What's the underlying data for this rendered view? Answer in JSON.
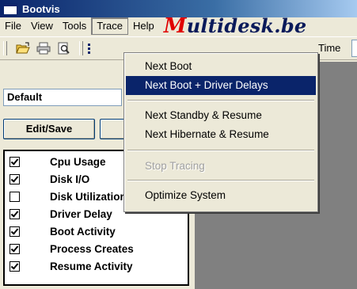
{
  "window": {
    "title": "Bootvis"
  },
  "menubar": {
    "items": [
      "File",
      "View",
      "Tools",
      "Trace",
      "Help"
    ],
    "brand": "Multidesk.be"
  },
  "toolbar": {
    "time_label": "Time"
  },
  "left_panel": {
    "preset_value": "Default",
    "edit_save_label": "Edit/Save",
    "checklist": [
      {
        "label": "Cpu Usage",
        "checked": true
      },
      {
        "label": "Disk I/O",
        "checked": true
      },
      {
        "label": "Disk Utilization",
        "checked": false
      },
      {
        "label": "Driver Delay",
        "checked": true
      },
      {
        "label": "Boot Activity",
        "checked": true
      },
      {
        "label": "Process Creates",
        "checked": true
      },
      {
        "label": "Resume Activity",
        "checked": true
      }
    ]
  },
  "trace_menu": {
    "items": [
      {
        "label": "Next Boot",
        "highlighted": false,
        "enabled": true
      },
      {
        "label": "Next Boot + Driver Delays",
        "highlighted": true,
        "enabled": true
      },
      {
        "label": "Next Standby & Resume",
        "highlighted": false,
        "enabled": true
      },
      {
        "label": "Next Hibernate & Resume",
        "highlighted": false,
        "enabled": true
      },
      {
        "label": "Stop Tracing",
        "highlighted": false,
        "enabled": false
      },
      {
        "label": "Optimize System",
        "highlighted": false,
        "enabled": true
      }
    ]
  },
  "colors": {
    "highlight": "#0a246a",
    "workspace": "#808080",
    "face": "#ece9d8",
    "brand_accent": "#e00000"
  },
  "icons": [
    "app-icon",
    "open-folder-icon",
    "print-icon",
    "print-preview-icon",
    "list-icon"
  ]
}
